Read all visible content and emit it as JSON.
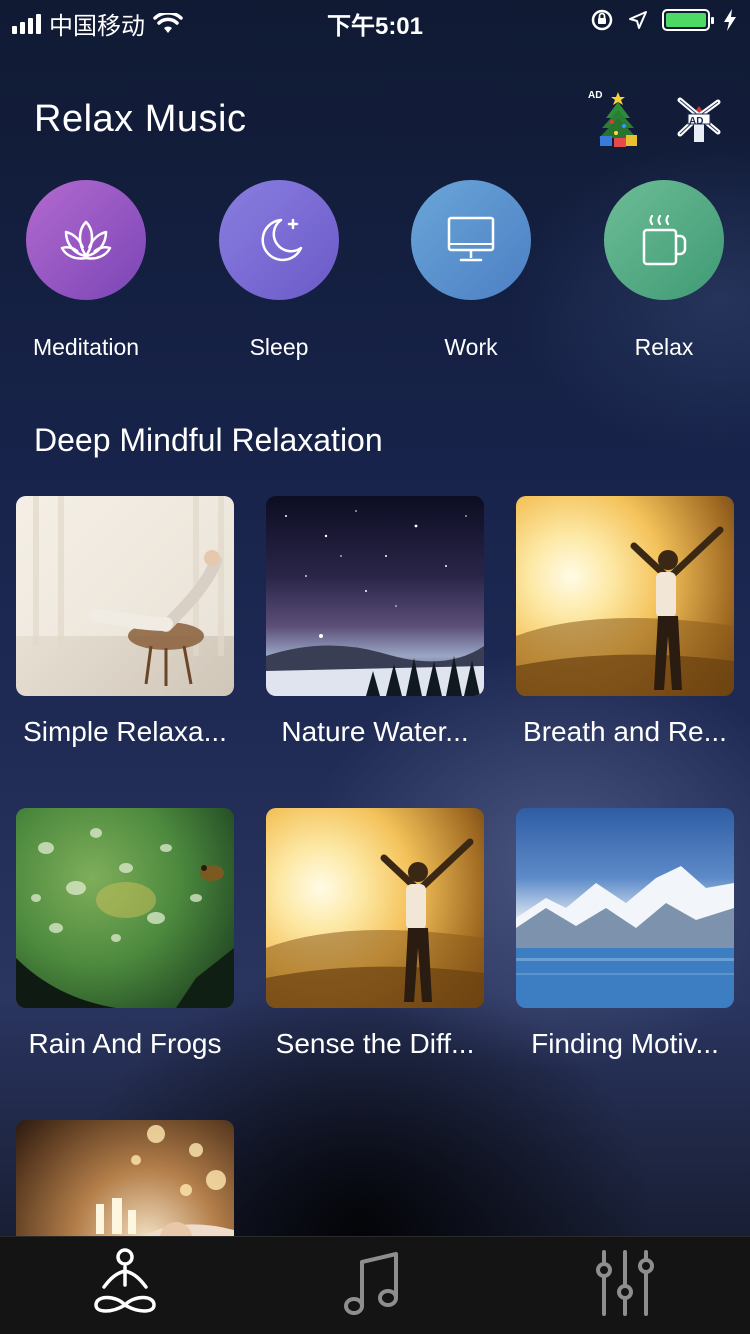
{
  "status_bar": {
    "carrier": "中国移动",
    "time": "下午5:01"
  },
  "header": {
    "title": "Relax Music",
    "ad_badge": "AD",
    "ad_badge_2": "AD"
  },
  "categories": [
    {
      "label": "Meditation",
      "icon": "lotus-icon",
      "color_from": "#b36ad0",
      "color_to": "#7a45b5"
    },
    {
      "label": "Sleep",
      "icon": "moon-icon",
      "color_from": "#8a7ee0",
      "color_to": "#6a5ac8"
    },
    {
      "label": "Work",
      "icon": "monitor-icon",
      "color_from": "#6aa6d8",
      "color_to": "#4c7fc4"
    },
    {
      "label": "Relax",
      "icon": "coffee-cup-icon",
      "color_from": "#6dbd96",
      "color_to": "#3f9a74"
    }
  ],
  "section": {
    "title": "Deep Mindful Relaxation"
  },
  "tracks": [
    {
      "title": "Simple Relaxa..."
    },
    {
      "title": "Nature Water..."
    },
    {
      "title": "Breath and Re..."
    },
    {
      "title": "Rain And Frogs"
    },
    {
      "title": "Sense the Diff..."
    },
    {
      "title": "Finding Motiv..."
    },
    {
      "title": ""
    }
  ],
  "tab_bar": {
    "tabs": [
      {
        "icon": "meditation-person-icon",
        "active": true
      },
      {
        "icon": "music-note-icon",
        "active": false
      },
      {
        "icon": "equalizer-sliders-icon",
        "active": false
      }
    ]
  }
}
